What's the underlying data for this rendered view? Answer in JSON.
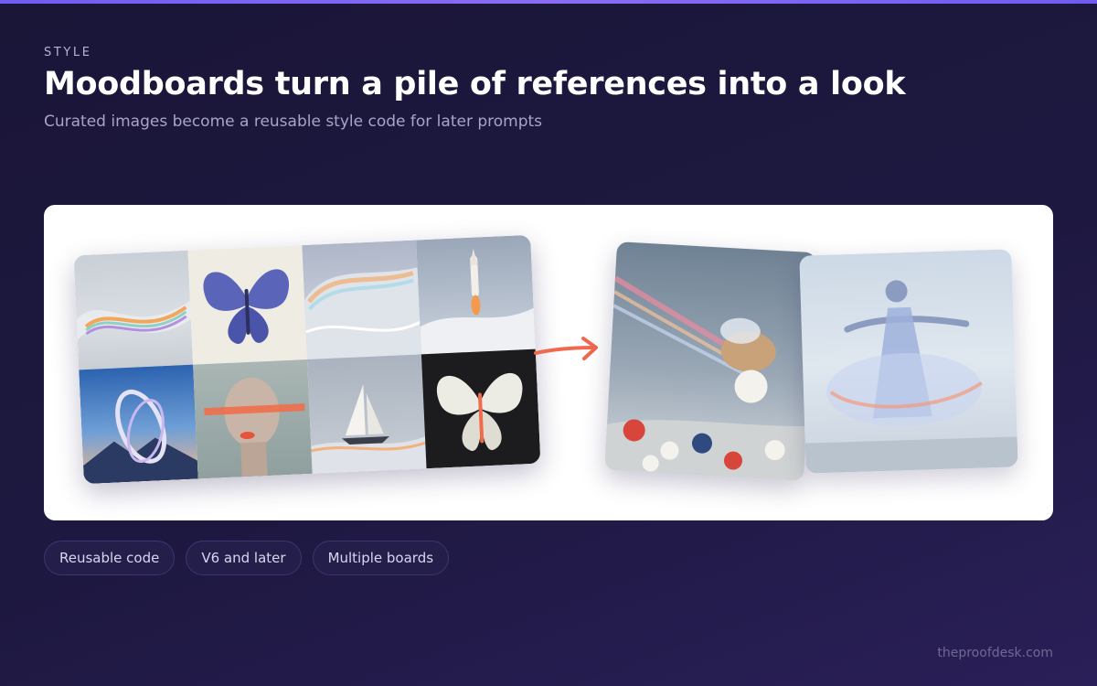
{
  "header": {
    "eyebrow": "STYLE",
    "title": "Moodboards turn a pile of references into a look",
    "subtitle": "Curated images become a reusable style code for later prompts"
  },
  "illustration": {
    "collage_tiles": [
      "iridescent-wave",
      "blue-butterfly",
      "iridescent-wave",
      "rocket-launch",
      "ring-sculpture-sunset",
      "mannequin-head-light-streak",
      "sailboat",
      "white-butterfly"
    ],
    "outputs": [
      "bee-on-flowers",
      "dancer-blur"
    ],
    "arrow_color": "#f0694f"
  },
  "chips": [
    "Reusable code",
    "V6 and later",
    "Multiple boards"
  ],
  "footer": {
    "site": "theproofdesk.com"
  },
  "colors": {
    "background": "#1d1840",
    "accent": "#7a66f4",
    "chip_bg": "#241f4a",
    "card_bg": "#ffffff"
  }
}
